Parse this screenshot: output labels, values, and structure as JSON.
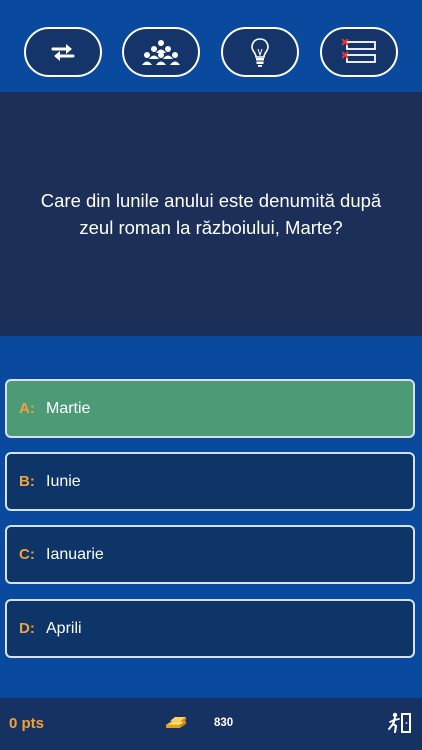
{
  "lifelines": [
    {
      "icon": "swap-arrows-icon"
    },
    {
      "icon": "audience-icon"
    },
    {
      "icon": "lightbulb-icon"
    },
    {
      "icon": "fifty-fifty-list-icon"
    }
  ],
  "question": {
    "text": "Care din lunile anului este denumită după zeul roman la războiului, Marte?"
  },
  "answers": [
    {
      "letter": "A:",
      "text": "Martie",
      "selected": true
    },
    {
      "letter": "B:",
      "text": "Iunie",
      "selected": false
    },
    {
      "letter": "C:",
      "text": "Ianuarie",
      "selected": false
    },
    {
      "letter": "D:",
      "text": "Aprili",
      "selected": false
    }
  ],
  "footer": {
    "points": "0 pts",
    "coins": "830"
  },
  "colors": {
    "background": "#0a4a9e",
    "question_panel": "#1b2f58",
    "answer_default": "#0d3568",
    "answer_selected": "#4d9a77",
    "accent_orange": "#f4a13a",
    "footer": "#153263"
  }
}
